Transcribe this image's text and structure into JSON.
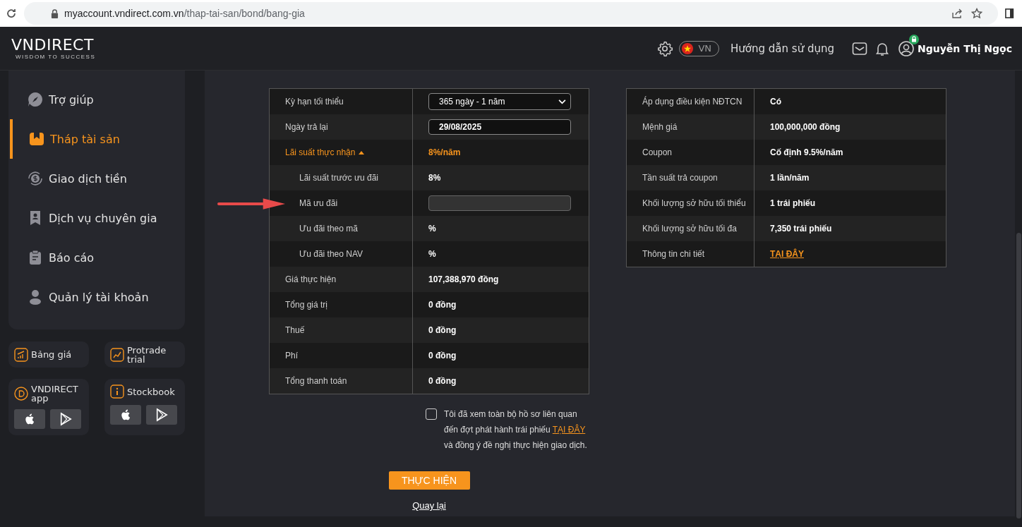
{
  "browser": {
    "url_host": "myaccount.vndirect.com.vn",
    "url_path": "/thap-tai-san/bond/bang-gia"
  },
  "header": {
    "logo": "VNDIRECT",
    "tagline": "WISDOM TO SUCCESS",
    "language": "VN",
    "help": "Hướng dẫn sử dụng",
    "user_name": "Nguyễn Thị Ngọc"
  },
  "sidebar": {
    "items": [
      {
        "label": "Trợ giúp",
        "selected": false
      },
      {
        "label": "Tháp tài sản",
        "selected": true
      },
      {
        "label": "Giao dịch tiền",
        "selected": false
      },
      {
        "label": "Dịch vụ chuyên gia",
        "selected": false
      },
      {
        "label": "Báo cáo",
        "selected": false
      },
      {
        "label": "Quản lý tài khoản",
        "selected": false
      }
    ],
    "tiles": [
      {
        "label": "Bảng giá",
        "kind": "link"
      },
      {
        "label": "Protrade trial",
        "kind": "link"
      },
      {
        "label": "VNDIRECT app",
        "kind": "app"
      },
      {
        "label": "Stockbook",
        "kind": "app"
      }
    ]
  },
  "left_table": {
    "rows": [
      {
        "label": "Kỳ hạn tối thiểu",
        "kind": "select",
        "value": "365 ngày - 1 năm"
      },
      {
        "label": "Ngày trả lại",
        "kind": "date",
        "value": "29/08/2025"
      },
      {
        "label": "Lãi suất thực nhận",
        "kind": "expandable",
        "value": "8%/năm",
        "expanded": true,
        "children": [
          {
            "label": "Lãi suất trước ưu đãi",
            "kind": "text",
            "value": "8%"
          },
          {
            "label": "Mã ưu đãi",
            "kind": "input"
          },
          {
            "label": "Ưu đãi theo mã",
            "kind": "text",
            "value": "%"
          },
          {
            "label": "Ưu đãi theo NAV",
            "kind": "text",
            "value": "%"
          }
        ]
      },
      {
        "label": "Giá thực hiện",
        "kind": "text",
        "value": "107,388,970 đồng"
      },
      {
        "label": "Tổng giá trị",
        "kind": "text",
        "value": "0 đồng"
      },
      {
        "label": "Thuế",
        "kind": "text",
        "value": "0 đồng"
      },
      {
        "label": "Phí",
        "kind": "text",
        "value": "0 đồng"
      },
      {
        "label": "Tổng thanh toán",
        "kind": "text",
        "value": "0 đồng"
      }
    ]
  },
  "right_table": {
    "rows": [
      {
        "label": "Áp dụng điều kiện NĐTCN",
        "kind": "text",
        "value": "Có"
      },
      {
        "label": "Mệnh giá",
        "kind": "text",
        "value": "100,000,000 đồng"
      },
      {
        "label": "Coupon",
        "kind": "text",
        "value": "Cố định 9.5%/năm"
      },
      {
        "label": "Tần suất trả coupon",
        "kind": "text",
        "value": "1 lần/năm"
      },
      {
        "label": "Khối lượng sở hữu tối thiểu",
        "kind": "text",
        "value": "1 trái phiếu"
      },
      {
        "label": "Khối lượng sở hữu tối đa",
        "kind": "text",
        "value": "7,350 trái phiếu"
      },
      {
        "label": "Thông tin chi tiết",
        "kind": "link",
        "value": "TẠI ĐÂY"
      }
    ]
  },
  "agreement": {
    "checked": false,
    "text_before": "Tôi đã xem toàn bộ hồ sơ liên quan đến đợt phát hành trái phiếu",
    "link": "TẠI ĐÂY",
    "text_after": "và đồng ý đề nghị thực hiện giao dịch."
  },
  "submit_button": "THỰC HIỆN",
  "back_link": "Quay lại"
}
